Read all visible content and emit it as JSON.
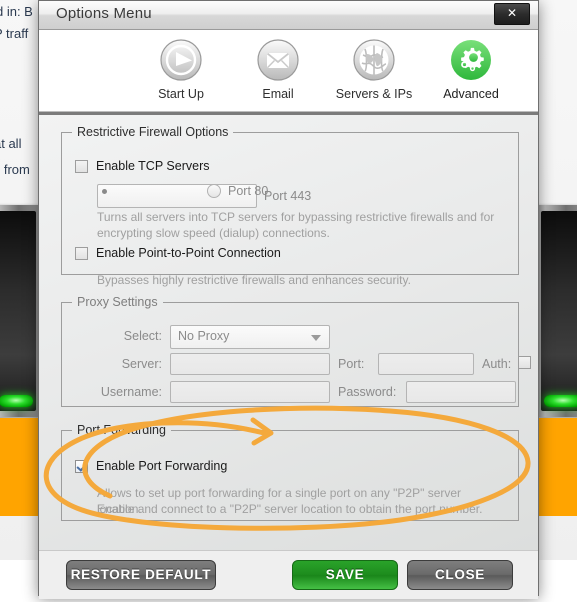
{
  "background": {
    "text_fragments": [
      "d in: B",
      "P traff",
      "at all",
      "d from"
    ],
    "accent_color": "#ffa400"
  },
  "window": {
    "title": "Options Menu",
    "close_label": "✕"
  },
  "tabs": [
    {
      "label": "Start Up",
      "icon": "play-circle-icon",
      "active": false
    },
    {
      "label": "Email",
      "icon": "envelope-icon",
      "active": false
    },
    {
      "label": "Servers & IPs",
      "icon": "globe-icon",
      "active": false
    },
    {
      "label": "Advanced",
      "icon": "gear-icon",
      "active": true
    }
  ],
  "firewall": {
    "legend": "Restrictive Firewall Options",
    "tcp_checkbox": {
      "label": "Enable TCP Servers",
      "checked": false
    },
    "ports": [
      {
        "label": "Port 443",
        "selected": true
      },
      {
        "label": "Port 80",
        "selected": false
      }
    ],
    "tcp_hint_line1": "Turns all servers into TCP servers for bypassing restrictive firewalls and for",
    "tcp_hint_line2": "encrypting slow speed (dialup) connections.",
    "p2p_checkbox": {
      "label": "Enable Point-to-Point Connection",
      "checked": false
    },
    "p2p_hint": "Bypasses highly restrictive firewalls and enhances security."
  },
  "proxy": {
    "legend": "Proxy Settings",
    "select_label": "Select:",
    "select_value": "No Proxy",
    "server_label": "Server:",
    "server_value": "",
    "port_label": "Port:",
    "port_value": "",
    "auth_label": "Auth:",
    "auth_checked": false,
    "username_label": "Username:",
    "username_value": "",
    "password_label": "Password:",
    "password_value": ""
  },
  "port_forwarding": {
    "legend": "Port Forwarding",
    "checkbox": {
      "label": "Enable Port Forwarding",
      "checked": true
    },
    "hint_line1": "Allows to set up port forwarding for a single port on any \"P2P\" server location.",
    "hint_line2": "Enable and connect to a \"P2P\" server location to obtain the port number."
  },
  "footer": {
    "restore_label": "RESTORE DEFAULT",
    "save_label": "SAVE",
    "close_label": "CLOSE"
  },
  "annotation": {
    "color": "#f4a93c",
    "shape": "ellipse-with-arrow",
    "target": "port-forwarding-group"
  }
}
